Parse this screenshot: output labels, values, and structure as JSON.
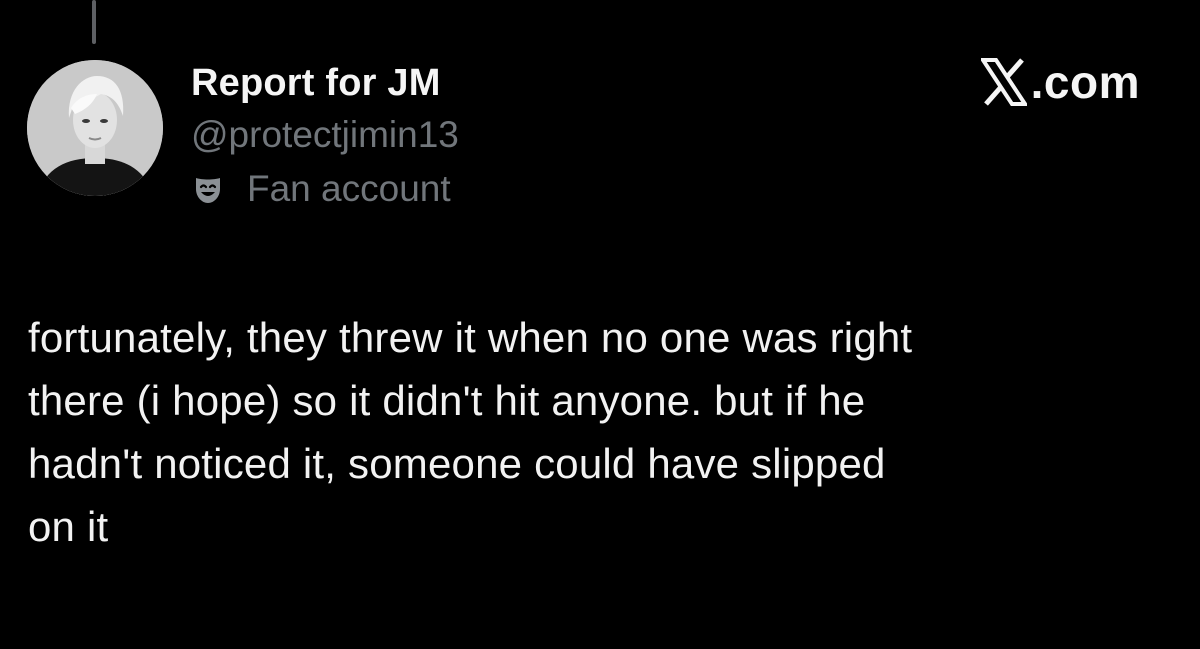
{
  "author": {
    "display_name": "Report for JM",
    "handle": "@protectjimin13",
    "label": "Fan account",
    "label_icon": "theater-mask-icon"
  },
  "brand": {
    "logo_icon": "x-logo-icon",
    "text": ".com"
  },
  "post": {
    "lines": [
      "fortunately, they threw it when no one was right",
      "there (i hope) so it didn't hit anyone. but if he",
      "hadn't noticed it, someone could have slipped",
      "on it"
    ]
  },
  "colors": {
    "background": "#000000",
    "primary_text": "#e7e9ea",
    "secondary_text": "#71767b"
  }
}
